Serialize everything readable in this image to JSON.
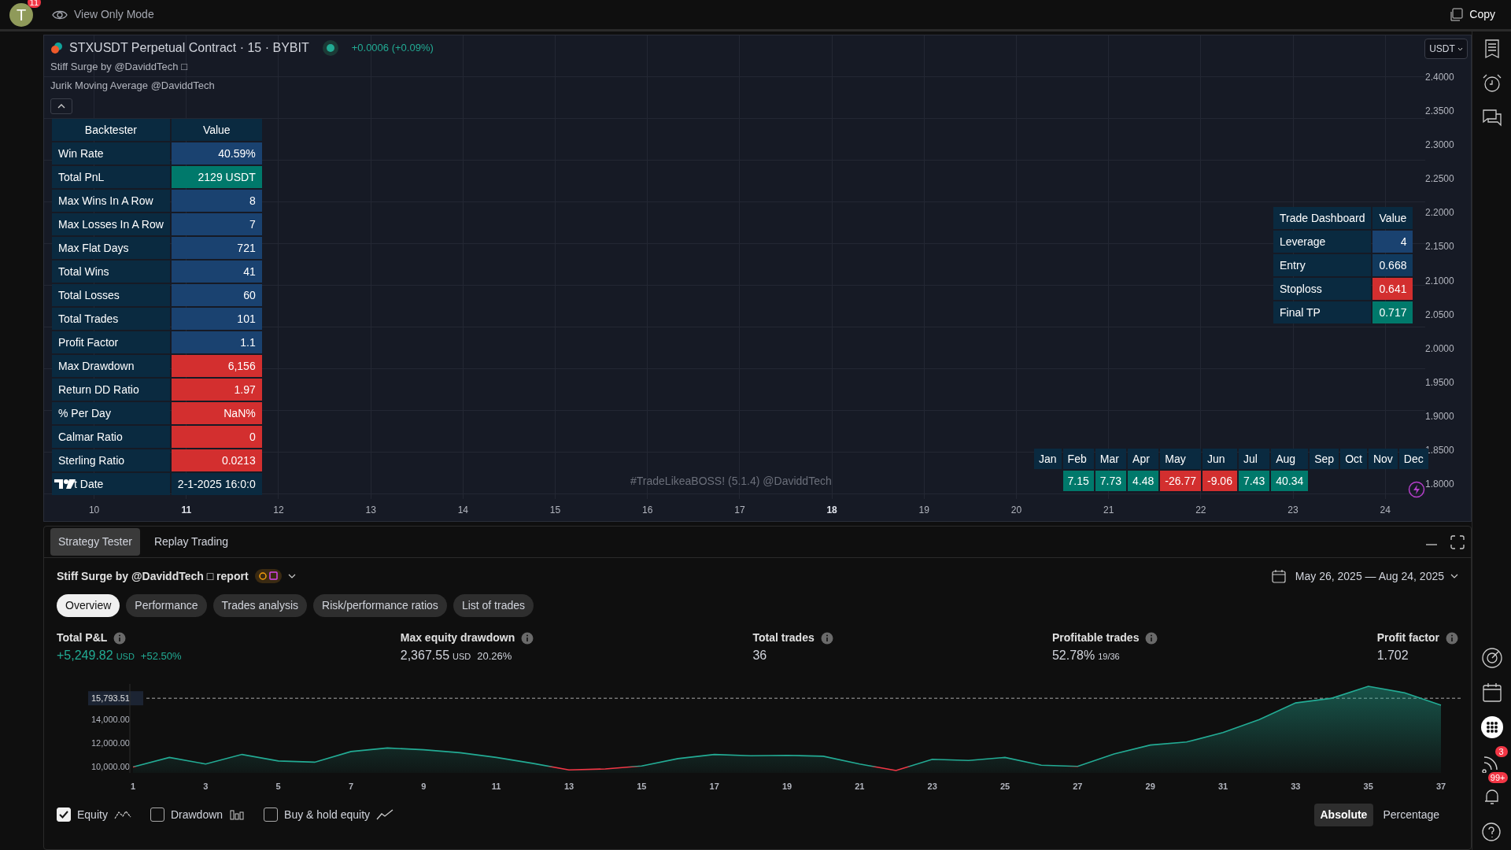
{
  "top_bar": {
    "avatar": "T",
    "avatar_badge": "11",
    "mode": "View Only Mode",
    "copy": "Copy"
  },
  "chart": {
    "symbol": "STXUSDT Perpetual Contract · 15 · BYBIT",
    "change": "+0.0006 (+0.09%)",
    "indicators": [
      "Stiff Surge by @DaviddTech □",
      "Jurik Moving Average @DaviddTech"
    ],
    "currency": "USDT",
    "price_axis": [
      "2.4000",
      "2.3500",
      "2.3000",
      "2.2500",
      "2.2000",
      "2.1500",
      "2.1000",
      "2.0500",
      "2.0000",
      "1.9500",
      "1.9000",
      "1.8500",
      "1.8000"
    ],
    "time_axis": [
      {
        "label": "10",
        "bold": false
      },
      {
        "label": "11",
        "bold": true
      },
      {
        "label": "12",
        "bold": false
      },
      {
        "label": "13",
        "bold": false
      },
      {
        "label": "14",
        "bold": false
      },
      {
        "label": "15",
        "bold": false
      },
      {
        "label": "16",
        "bold": false
      },
      {
        "label": "17",
        "bold": false
      },
      {
        "label": "18",
        "bold": true
      },
      {
        "label": "19",
        "bold": false
      },
      {
        "label": "20",
        "bold": false
      },
      {
        "label": "21",
        "bold": false
      },
      {
        "label": "22",
        "bold": false
      },
      {
        "label": "23",
        "bold": false
      },
      {
        "label": "24",
        "bold": false
      }
    ],
    "signature": "#TradeLikeaBOSS! (5.1.4) @DaviddTech",
    "backtester": {
      "columns": [
        "Backtester",
        "Value"
      ],
      "rows": [
        {
          "label": "Win Rate",
          "value": "40.59%",
          "color": "#1a4270"
        },
        {
          "label": "Total PnL",
          "value": "2129 USDT",
          "color": "#00796b"
        },
        {
          "label": "Max Wins In A Row",
          "value": "8",
          "color": "#1a4270"
        },
        {
          "label": "Max Losses In A Row",
          "value": "7",
          "color": "#1a4270"
        },
        {
          "label": "Max Flat Days",
          "value": "721",
          "color": "#1a4270"
        },
        {
          "label": "Total Wins",
          "value": "41",
          "color": "#1a4270"
        },
        {
          "label": "Total Losses",
          "value": "60",
          "color": "#1a4270"
        },
        {
          "label": "Total Trades",
          "value": "101",
          "color": "#1a4270"
        },
        {
          "label": "Profit Factor",
          "value": "1.1",
          "color": "#1a4270"
        },
        {
          "label": "Max Drawdown",
          "value": "6,156",
          "color": "#d32f2f"
        },
        {
          "label": "Return DD Ratio",
          "value": "1.97",
          "color": "#d32f2f"
        },
        {
          "label": "% Per Day",
          "value": "NaN%",
          "color": "#d32f2f"
        },
        {
          "label": "Calmar Ratio",
          "value": "0",
          "color": "#d32f2f"
        },
        {
          "label": "Sterling Ratio",
          "value": "0.0213",
          "color": "#d32f2f"
        },
        {
          "label": "t Date",
          "value": "2-1-2025 16:0:0",
          "color": "#0a2a40"
        }
      ]
    },
    "trade_dashboard": {
      "columns": [
        "Trade Dashboard",
        "Value"
      ],
      "rows": [
        {
          "label": "Leverage",
          "value": "4",
          "color": "#1a4270"
        },
        {
          "label": "Entry",
          "value": "0.668",
          "color": "#113a5e"
        },
        {
          "label": "Stoploss",
          "value": "0.641",
          "color": "#d32f2f"
        },
        {
          "label": "Final TP",
          "value": "0.717",
          "color": "#00796b"
        }
      ]
    },
    "monthly": [
      {
        "label": "Jan"
      },
      {
        "label": "Feb",
        "value": "7.15",
        "color": "#00796b"
      },
      {
        "label": "Mar",
        "value": "7.73",
        "color": "#00796b"
      },
      {
        "label": "Apr",
        "value": "4.48",
        "color": "#00796b"
      },
      {
        "label": "May",
        "value": "-26.77",
        "color": "#d32f2f"
      },
      {
        "label": "Jun",
        "value": "-9.06",
        "color": "#d32f2f"
      },
      {
        "label": "Jul",
        "value": "7.43",
        "color": "#00796b"
      },
      {
        "label": "Aug",
        "value": "40.34",
        "color": "#00796b"
      },
      {
        "label": "Sep"
      },
      {
        "label": "Oct"
      },
      {
        "label": "Nov"
      },
      {
        "label": "Dec"
      }
    ]
  },
  "sidebar": {
    "feed_badge": "3",
    "alerts_badge": "99+"
  },
  "panel": {
    "tabs": [
      {
        "label": "Strategy Tester",
        "selected": true
      },
      {
        "label": "Replay Trading",
        "selected": false
      }
    ],
    "strategy": "Stiff Surge by @DaviddTech □ report",
    "date_range": "May 26, 2025 — Aug 24, 2025",
    "subtabs": [
      {
        "label": "Overview",
        "selected": true
      },
      {
        "label": "Performance",
        "selected": false
      },
      {
        "label": "Trades analysis",
        "selected": false
      },
      {
        "label": "Risk/performance ratios",
        "selected": false
      },
      {
        "label": "List of trades",
        "selected": false
      }
    ],
    "stats": [
      {
        "label": "Total P&L",
        "value": "+5,249.82",
        "unit": "USD",
        "extra": "+52.50%",
        "color": "#22ab94"
      },
      {
        "label": "Max equity drawdown",
        "value": "2,367.55",
        "unit": "USD",
        "extra": "20.26%",
        "color": "#d1d4dc"
      },
      {
        "label": "Total trades",
        "value": "36",
        "color": "#d1d4dc"
      },
      {
        "label": "Profitable trades",
        "value": "52.78%",
        "extra": "19/36",
        "color": "#d1d4dc"
      },
      {
        "label": "Profit factor",
        "value": "1.702",
        "color": "#d1d4dc"
      }
    ],
    "equity": {
      "chart_data": {
        "type": "area",
        "x": [
          1,
          2,
          3,
          4,
          5,
          6,
          7,
          8,
          9,
          10,
          11,
          12,
          13,
          14,
          15,
          16,
          17,
          18,
          19,
          20,
          21,
          22,
          23,
          24,
          25,
          26,
          27,
          28,
          29,
          30,
          31,
          32,
          33,
          34,
          35,
          36,
          37
        ],
        "series": [
          {
            "color": "#22ab94",
            "values": [
              10000,
              10800,
              10250,
              11050,
              10500,
              10400,
              11300,
              11600,
              11450,
              11200,
              10800,
              10300,
              9750,
              9830,
              10080,
              10700,
              11050,
              10950,
              10980,
              10900,
              10250,
              9700,
              10650,
              10550,
              10800,
              10150,
              10050,
              11100,
              11850,
              12100,
              12900,
              14000,
              15400,
              15800,
              16800,
              16250,
              15200
            ]
          }
        ],
        "xticks": [
          1,
          3,
          5,
          7,
          9,
          11,
          13,
          15,
          17,
          19,
          21,
          23,
          25,
          27,
          29,
          31,
          33,
          35,
          37
        ],
        "xlim": [
          1,
          37
        ],
        "ylim": [
          9500,
          17000
        ],
        "yticks": [
          {
            "value": 10000,
            "label": "10,000.00"
          },
          {
            "value": 12000,
            "label": "12,000.00"
          },
          {
            "value": 14000,
            "label": "14,000.00"
          },
          {
            "value": 15793.51,
            "label": "15,793.51"
          }
        ]
      }
    },
    "legend": [
      {
        "label": "Equity",
        "checked": true
      },
      {
        "label": "Drawdown",
        "checked": false
      },
      {
        "label": "Buy & hold equity",
        "checked": false
      }
    ],
    "modes": [
      {
        "label": "Absolute",
        "selected": true
      },
      {
        "label": "Percentage",
        "selected": false
      }
    ]
  }
}
